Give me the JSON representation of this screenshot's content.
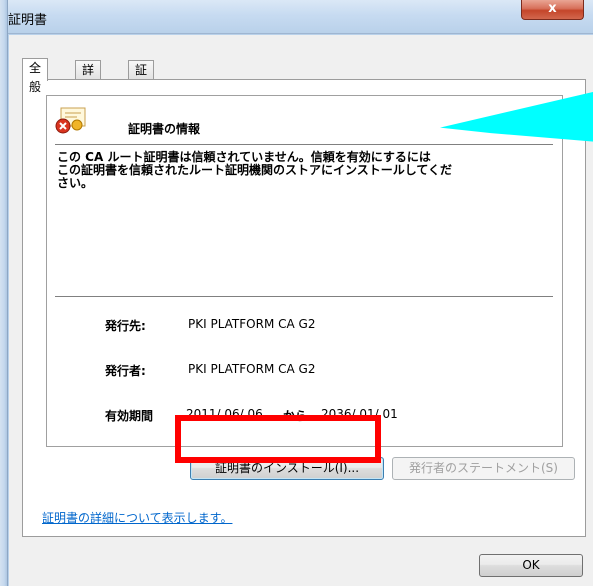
{
  "window": {
    "title": "証明書",
    "close_label": "x"
  },
  "tabs": [
    {
      "label": "全般",
      "active": true
    },
    {
      "label": "詳細",
      "active": false
    },
    {
      "label": "証明のパス",
      "active": false
    }
  ],
  "cert_info": {
    "heading": "証明書の情報",
    "description_line1": "この CA ルート証明書は信頼されていません。信頼を有効にするには",
    "description_line2": "この証明書を信頼されたルート証明機関のストアにインストールしてくだ",
    "description_line3": "さい。",
    "icon": "certificate-error-icon"
  },
  "fields": {
    "issued_to_label": "発行先:",
    "issued_to_value": "PKI PLATFORM CA G2",
    "issued_by_label": "発行者:",
    "issued_by_value": "PKI PLATFORM CA G2",
    "validity_label": "有効期間",
    "valid_from": "2011/ 06/ 06",
    "validity_connector": "から",
    "valid_to": "2036/ 01/ 01"
  },
  "buttons": {
    "install": "証明書のインストール(I)...",
    "issuer_statement": "発行者のステートメント(S)",
    "ok": "OK"
  },
  "link": {
    "details": "証明書の詳細について表示します。"
  },
  "colors": {
    "highlight": "#ff0000",
    "annotation": "#00ffff",
    "link": "#0066cc"
  }
}
